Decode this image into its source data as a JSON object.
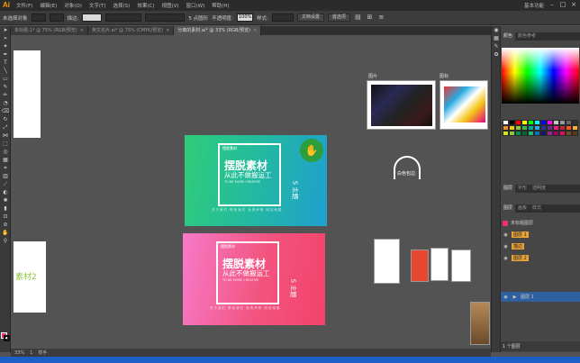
{
  "app": {
    "logo": "Ai",
    "workspace": "基本功能"
  },
  "menu": [
    "文件(F)",
    "编辑(E)",
    "对象(O)",
    "文字(T)",
    "选择(S)",
    "效果(C)",
    "视图(V)",
    "窗口(W)",
    "帮助(H)"
  ],
  "controlbar": {
    "selection_label": "未选择对象",
    "stroke_label": "描边:",
    "point_value": "5 点圆形",
    "opacity_label": "不透明度:",
    "opacity_value": "100%",
    "style_label": "样式:",
    "doc_settings": "文档设置",
    "preferences": "首选项"
  },
  "tabs": [
    {
      "label": "未标题-1* @ 75% (RGB/预览)",
      "active": false
    },
    {
      "label": "英文名片.ai* @ 75% (CMYK/预览)",
      "active": false
    },
    {
      "label": "分离的素材.ai* @ 33% (RGB/预览)",
      "active": true
    }
  ],
  "canvas": {
    "left_label": "素材2",
    "thumb_label_1": "图片",
    "thumb_label_2": "图标",
    "logo_caption": "白色包边",
    "cards": [
      {
        "logo": "摆脱素材",
        "title": "摆脱素材",
        "subtitle": "从此不做搬运工",
        "small": "TO BE MORE CREATIVE",
        "badge": "S 主题",
        "footer": "关于我们 联系我们 免责声明 网站地图"
      },
      {
        "logo": "摆脱素材",
        "title": "摆脱素材",
        "subtitle": "从此不做搬运工",
        "small": "TO BE MORE CREATIVE",
        "badge": "S 主题",
        "footer": "关于我们 联系我们 免责声明 网站地图"
      }
    ]
  },
  "panels": {
    "color_tabs": [
      "颜色",
      "颜色参考"
    ],
    "lower_tabs": [
      "图层",
      "字形",
      "透明度"
    ],
    "layer_tabs": [
      "图层",
      "画板",
      "样式"
    ],
    "layers": [
      {
        "name": "未标题图层",
        "visible": true
      },
      {
        "name": "图层 1",
        "visible": true
      },
      {
        "name": "描边",
        "visible": true
      },
      {
        "name": "图层 2",
        "visible": true
      },
      {
        "name": "图层 1",
        "visible": true
      }
    ],
    "layer_count": "1 个图层",
    "swatch_colors": [
      "#ffffff",
      "#000000",
      "#ff0000",
      "#ffff00",
      "#00ff00",
      "#00ffff",
      "#0000ff",
      "#ff00ff",
      "#c8c8c8",
      "#999999",
      "#666666",
      "#333333",
      "#f28c28",
      "#f5c518",
      "#8cc63f",
      "#39b54a",
      "#00a99d",
      "#29abe2",
      "#2e3192",
      "#662d91",
      "#ed1e79",
      "#c1272d",
      "#f15a24",
      "#fbb03b",
      "#d9e021",
      "#8cc63f",
      "#009245",
      "#006837",
      "#22b573",
      "#0071bc",
      "#1b1464",
      "#93278f",
      "#9e005d",
      "#d4145a",
      "#754c24",
      "#603813"
    ]
  },
  "status": {
    "zoom": "33%",
    "page": "1",
    "tool": "抓手"
  }
}
